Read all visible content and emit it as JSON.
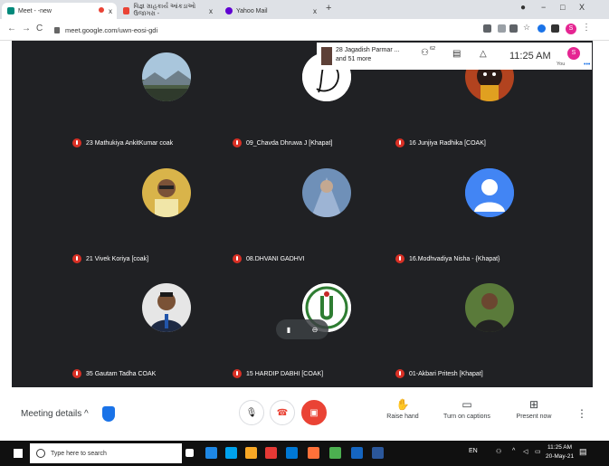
{
  "browser": {
    "tabs": [
      {
        "title": "Meet - -new",
        "favicon_color": "#00897b"
      },
      {
        "title": "વિજ્ઞ ગ્રાહકાર્ય આંકડાઓ ઉજાગરા - ",
        "favicon_color": "#ea4335"
      },
      {
        "title": "Yahoo Mail",
        "favicon_color": "#6001d2"
      }
    ],
    "new_tab": "+",
    "window_controls": {
      "minimize": "−",
      "maximize": "□",
      "close": "X"
    },
    "url": "meet.google.com/uwn-eosi-gdi",
    "profile_initial": "S"
  },
  "meet": {
    "presenter": {
      "line1": "28 Jagadish Parmar ...",
      "line2": "and 51 more"
    },
    "participant_count": "62",
    "time": "11:25 AM",
    "self_label": "You",
    "self_initial": "S",
    "participants": [
      {
        "name": "23 Mathukiya AnkitKumar coak",
        "avatar": "landscape"
      },
      {
        "name": "09_Chavda Dhruwa J [Khapat]",
        "avatar": "monogram-d"
      },
      {
        "name": "16 Junjiya Radhika [COAK]",
        "avatar": "deity"
      },
      {
        "name": "21 Vivek Koriya [coak]",
        "avatar": "photo-yellow"
      },
      {
        "name": "08.DHVANI GADHVI",
        "avatar": "photo-blue"
      },
      {
        "name": "16.Modhvadiya Nisha - {Khapat}",
        "avatar": "default-person"
      },
      {
        "name": "35 Gautam Tadha COAK",
        "avatar": "photo-suit"
      },
      {
        "name": "15 HARDIP DABHI [COAK]",
        "avatar": "logo-green"
      },
      {
        "name": "01-Akbari Pritesh [Khapat]",
        "avatar": "photo-outdoor"
      }
    ]
  },
  "controls": {
    "meeting_details": "Meeting details",
    "raise_hand": "Raise hand",
    "captions": "Turn on captions",
    "present": "Present now"
  },
  "taskbar": {
    "search_placeholder": "Type here to search",
    "language": "EN",
    "time": "11:25 AM",
    "date": "20-May-21"
  },
  "colors": {
    "stage": "#202124",
    "muted": "#d93025",
    "accent": "#1a73e8"
  }
}
